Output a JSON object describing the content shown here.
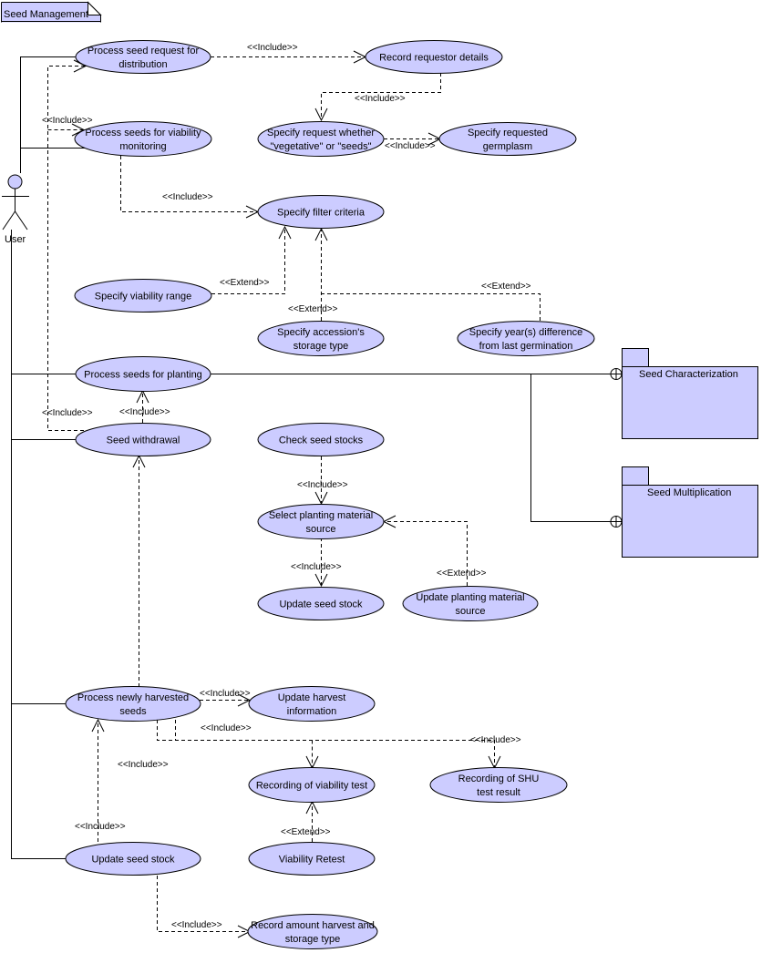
{
  "title": "Seed Management",
  "colors": {
    "fill": "#ccccff",
    "stroke": "#000000",
    "background": "#ffffff"
  },
  "actor": {
    "id": "user",
    "label": "User"
  },
  "packages": [
    {
      "id": "seed-characterization",
      "label": "Seed Characterization"
    },
    {
      "id": "seed-multiplication",
      "label": "Seed Multiplication"
    }
  ],
  "use_cases": [
    {
      "id": "process-seed-request",
      "lines": [
        "Process seed request for",
        "distribution"
      ]
    },
    {
      "id": "record-requestor",
      "lines": [
        "Record requestor details"
      ]
    },
    {
      "id": "process-viability-monitoring",
      "lines": [
        "Process seeds for viability",
        "monitoring"
      ]
    },
    {
      "id": "specify-request-whether",
      "lines": [
        "Specify request whether",
        "\"vegetative\" or \"seeds\""
      ]
    },
    {
      "id": "specify-requested-germplasm",
      "lines": [
        "Specify requested",
        "germplasm"
      ]
    },
    {
      "id": "specify-filter-criteria",
      "lines": [
        "Specify filter criteria"
      ]
    },
    {
      "id": "specify-viability-range",
      "lines": [
        "Specify viability range"
      ]
    },
    {
      "id": "specify-storage-type",
      "lines": [
        "Specify accession's",
        "storage type"
      ]
    },
    {
      "id": "specify-year-difference",
      "lines": [
        "Specify year(s) difference",
        "from last germination"
      ]
    },
    {
      "id": "process-planting",
      "lines": [
        "Process seeds for planting"
      ]
    },
    {
      "id": "seed-withdrawal",
      "lines": [
        "Seed withdrawal"
      ]
    },
    {
      "id": "check-seed-stocks",
      "lines": [
        "Check seed stocks"
      ]
    },
    {
      "id": "select-planting-source",
      "lines": [
        "Select planting material",
        "source"
      ]
    },
    {
      "id": "update-seed-stock-1",
      "lines": [
        "Update seed stock"
      ]
    },
    {
      "id": "update-planting-source",
      "lines": [
        "Update planting material",
        "source"
      ]
    },
    {
      "id": "process-newly-harvested",
      "lines": [
        "Process newly harvested",
        "seeds"
      ]
    },
    {
      "id": "update-harvest-info",
      "lines": [
        "Update harvest",
        "information"
      ]
    },
    {
      "id": "recording-viability-test",
      "lines": [
        "Recording of viability test"
      ]
    },
    {
      "id": "recording-shu",
      "lines": [
        "Recording of SHU",
        "test result"
      ]
    },
    {
      "id": "update-seed-stock-2",
      "lines": [
        "Update seed stock"
      ]
    },
    {
      "id": "viability-retest",
      "lines": [
        "Viability Retest"
      ]
    },
    {
      "id": "record-amount-harvest",
      "lines": [
        "Record amount harvest and",
        "storage type"
      ]
    }
  ],
  "associations": [
    {
      "from": "user",
      "to": "process-seed-request"
    },
    {
      "from": "user",
      "to": "process-viability-monitoring"
    },
    {
      "from": "user",
      "to": "process-planting"
    },
    {
      "from": "user",
      "to": "seed-withdrawal"
    },
    {
      "from": "user",
      "to": "process-newly-harvested"
    },
    {
      "from": "user",
      "to": "update-seed-stock-2"
    },
    {
      "from": "process-planting",
      "to": "seed-characterization"
    },
    {
      "from": "process-planting",
      "to": "seed-multiplication"
    }
  ],
  "relationships": [
    {
      "type": "include",
      "label": "<<Include>>",
      "from": "process-seed-request",
      "to": "record-requestor"
    },
    {
      "type": "include",
      "label": "<<Include>>",
      "from": "record-requestor",
      "to": "specify-request-whether"
    },
    {
      "type": "include",
      "label": "<<Include>>",
      "from": "specify-request-whether",
      "to": "specify-requested-germplasm"
    },
    {
      "type": "include",
      "label": "<<Include>>",
      "from": "process-viability-monitoring",
      "to": "specify-filter-criteria"
    },
    {
      "type": "include",
      "label": "<<Include>>",
      "from": "seed-withdrawal",
      "to": "process-seed-request"
    },
    {
      "type": "include",
      "label": "<<Include>>",
      "from": "seed-withdrawal",
      "to": "process-viability-monitoring"
    },
    {
      "type": "extend",
      "label": "<<Extend>>",
      "from": "specify-viability-range",
      "to": "specify-filter-criteria"
    },
    {
      "type": "extend",
      "label": "<<Extend>>",
      "from": "specify-storage-type",
      "to": "specify-filter-criteria"
    },
    {
      "type": "extend",
      "label": "<<Extend>>",
      "from": "specify-year-difference",
      "to": "specify-filter-criteria"
    },
    {
      "type": "include",
      "label": "<<Include>>",
      "from": "seed-withdrawal",
      "to": "process-planting"
    },
    {
      "type": "include",
      "label": "<<Include>>",
      "from": "check-seed-stocks",
      "to": "select-planting-source"
    },
    {
      "type": "include",
      "label": "<<Include>>",
      "from": "select-planting-source",
      "to": "update-seed-stock-1"
    },
    {
      "type": "extend",
      "label": "<<Extend>>",
      "from": "update-planting-source",
      "to": "select-planting-source"
    },
    {
      "type": "include",
      "label": "<<Include>>",
      "from": "process-newly-harvested",
      "to": "seed-withdrawal"
    },
    {
      "type": "include",
      "label": "<<Include>>",
      "from": "process-newly-harvested",
      "to": "update-harvest-info"
    },
    {
      "type": "include",
      "label": "<<Include>>",
      "from": "process-newly-harvested",
      "to": "recording-viability-test"
    },
    {
      "type": "include",
      "label": "<<Include>>",
      "from": "process-newly-harvested",
      "to": "recording-shu"
    },
    {
      "type": "include",
      "label": "<<Include>>",
      "from": "update-seed-stock-2",
      "to": "process-newly-harvested"
    },
    {
      "type": "extend",
      "label": "<<Extend>>",
      "from": "viability-retest",
      "to": "recording-viability-test"
    },
    {
      "type": "include",
      "label": "<<Include>>",
      "from": "update-seed-stock-2",
      "to": "record-amount-harvest"
    }
  ]
}
